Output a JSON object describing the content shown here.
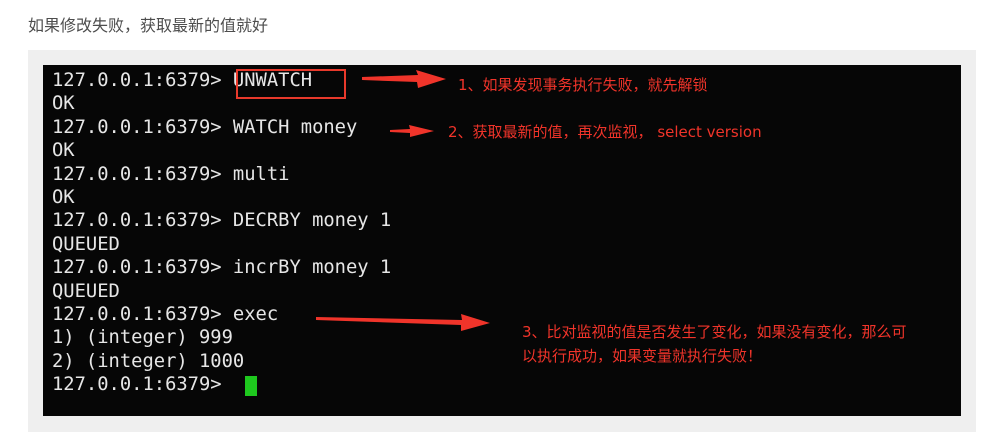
{
  "intro_text": "如果修改失败，获取最新的值就好",
  "terminal": {
    "lines": [
      "127.0.0.1:6379> UNWATCH",
      "OK",
      "127.0.0.1:6379> WATCH money",
      "OK",
      "127.0.0.1:6379> multi",
      "OK",
      "127.0.0.1:6379> DECRBY money 1",
      "QUEUED",
      "127.0.0.1:6379> incrBY money 1",
      "QUEUED",
      "127.0.0.1:6379> exec",
      "1) (integer) 999",
      "2) (integer) 1000",
      "127.0.0.1:6379> "
    ]
  },
  "annotations": {
    "note1": "1、如果发现事务执行失败，就先解锁",
    "note2": "2、获取最新的值，再次监视， select version",
    "note3_line1": "3、比对监视的值是否发生了变化，如果没有变化，那么可",
    "note3_line2": "以执行成功，如果变量就执行失败！"
  },
  "colors": {
    "annotation": "#f0342a",
    "cursor": "#1ec81e",
    "terminal_bg": "#060606",
    "terminal_text": "#e6e6e6"
  }
}
